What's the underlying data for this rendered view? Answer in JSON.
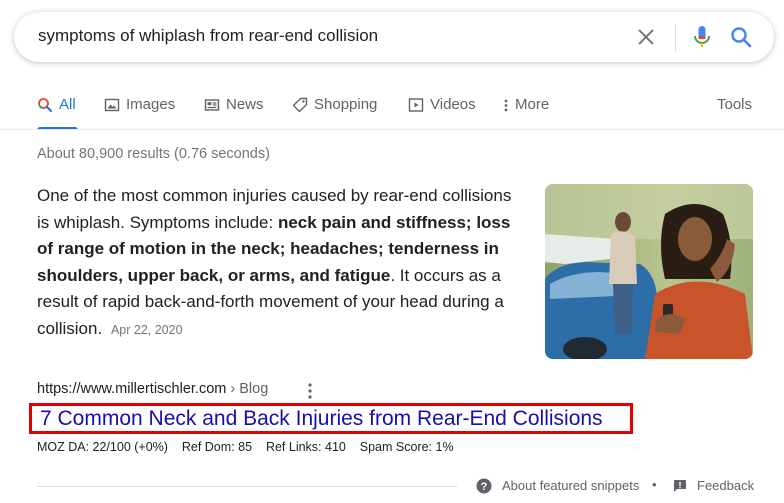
{
  "search": {
    "query": "symptoms of whiplash from rear-end collision"
  },
  "tabs": [
    {
      "label": "All",
      "icon": "search-icon",
      "active": true
    },
    {
      "label": "Images",
      "icon": "image-icon"
    },
    {
      "label": "News",
      "icon": "news-icon"
    },
    {
      "label": "Shopping",
      "icon": "tag-icon"
    },
    {
      "label": "Videos",
      "icon": "play-icon"
    },
    {
      "label": "More",
      "icon": "vertical-dots-icon"
    }
  ],
  "tools_label": "Tools",
  "stats": "About 80,900 results (0.76 seconds)",
  "snippet": {
    "part1": "One of the most common injuries caused by rear-end collisions is whiplash. Symptoms include: ",
    "bold": "neck pain and stiffness; loss of range of motion in the neck; headaches; tenderness in shoulders, upper back, or arms, and fatigue",
    "part2": ". It occurs as a result of rapid back-and-forth movement of your head during a collision.",
    "date": "Apr 22, 2020"
  },
  "result": {
    "url": "https://www.millertischler.com",
    "breadcrumb": " › Blog",
    "title": "7 Common Neck and Back Injuries from Rear-End Collisions",
    "highlight_color": "#e00000"
  },
  "moz": {
    "da": "MOZ DA: 22/100 (+0%)",
    "ref_dom": "Ref Dom: 85",
    "ref_links": "Ref Links: 410",
    "spam": "Spam Score: 1%"
  },
  "footer": {
    "about": "About featured snippets",
    "separator": "•",
    "feedback": "Feedback"
  },
  "colors": {
    "link": "#1a0dab",
    "accent": "#1a73e8",
    "muted": "#70757a"
  }
}
